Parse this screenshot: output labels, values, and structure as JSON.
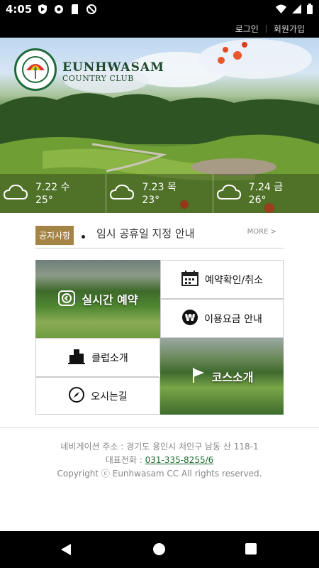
{
  "status_bar": {
    "time": "4:05",
    "left_icons": [
      "play-shield-icon",
      "gear-icon",
      "sd-card-icon",
      "no-sign-icon"
    ],
    "right_icons": [
      "wifi-icon",
      "signal-icon",
      "battery-icon"
    ]
  },
  "top_nav": {
    "login": "로그인",
    "signup": "회원가입"
  },
  "hero": {
    "brand_name": "EUNHWASAM",
    "brand_sub": "COUNTRY CLUB",
    "logo_ring_text": "PALMER COURSE DESIGN CO. · EUNHWASAM COUNTRY CLUB",
    "weather": [
      {
        "date": "7.22 수",
        "temp": "25°",
        "icon": "cloud-icon"
      },
      {
        "date": "7.23 목",
        "temp": "23°",
        "icon": "cloud-icon"
      },
      {
        "date": "7.24 금",
        "temp": "26°",
        "icon": "cloud-icon"
      }
    ]
  },
  "notice": {
    "badge": "공지사항",
    "text": "임시 공휴일 지정 안내",
    "more": "MORE >"
  },
  "menu": {
    "realtime_booking": "실시간 예약",
    "booking_check": "예약확인/취소",
    "fee_info": "이용요금 안내",
    "club_intro": "클럽소개",
    "course_intro": "코스소개",
    "directions": "오시는길"
  },
  "footer": {
    "address": "네비게이션 주소 : 경기도 용인시 처인구 남동 산 118-1",
    "phone_label": "대표전화 : ",
    "phone": "031-335-8255/6",
    "copyright": "Copyright ⓒ Eunhwasam CC All rights reserved."
  },
  "colors": {
    "notice_badge": "#a38445",
    "brand_green": "#214a2c",
    "phone_link": "#1a6b2e"
  }
}
